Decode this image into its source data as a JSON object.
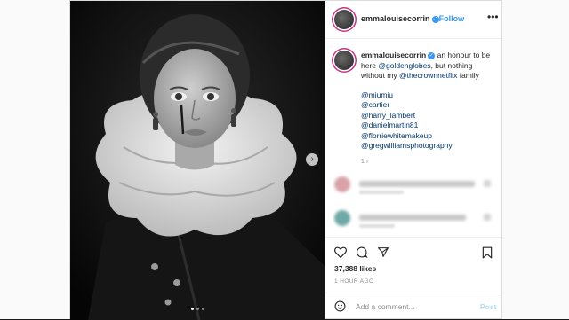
{
  "post": {
    "username": "emmalouisecorrin",
    "follow_label": "Follow",
    "more_label": "•••",
    "verified_mark": "✓",
    "caption": {
      "username": "emmalouisecorrin",
      "text_1": " an honour to be here ",
      "mention_1": "@goldenglobes",
      "text_2": ", but nothing without my ",
      "mention_2": "@thecrownnetflix",
      "text_3": " family ",
      "tags": [
        "@miumiu",
        "@cartier",
        "@harry_lambert",
        "@danielmartin81",
        "@florriewhitemakeup",
        "@gregwilliamsphotography"
      ],
      "time": "1h"
    },
    "likes": "37,388 likes",
    "posted_ago": "1 HOUR AGO",
    "comment_placeholder": "Add a comment...",
    "post_label": "Post",
    "carousel": {
      "count": 3,
      "active": 1
    },
    "colors": {
      "link": "#3897f0",
      "mention": "#003569",
      "verified": "#3897f0"
    },
    "icons": [
      "heart-icon",
      "comment-icon",
      "share-icon",
      "bookmark-icon",
      "emoji-icon",
      "chevron-right-icon",
      "more-icon"
    ]
  }
}
